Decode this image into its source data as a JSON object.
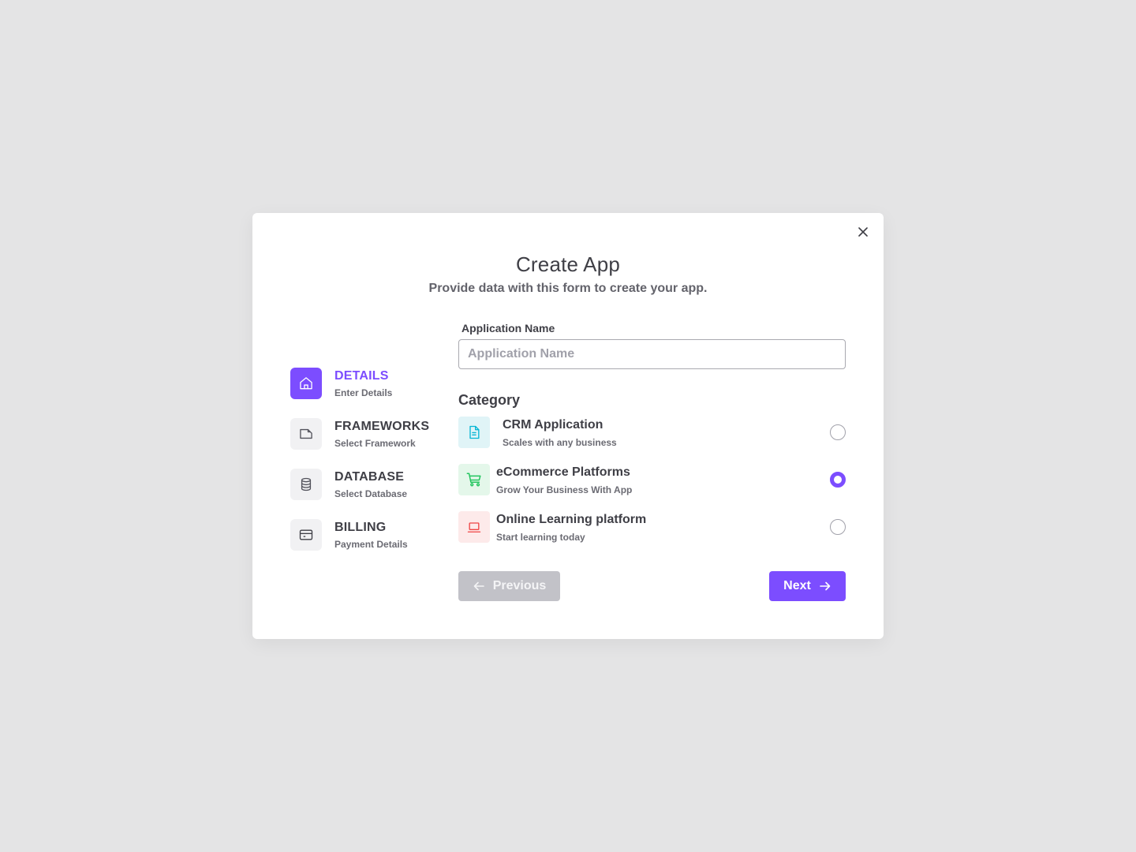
{
  "modal": {
    "title": "Create App",
    "subtitle": "Provide data with this form to create your app.",
    "close_icon": "close-icon"
  },
  "steps": [
    {
      "title": "DETAILS",
      "subtitle": "Enter Details",
      "icon": "home-icon",
      "active": true
    },
    {
      "title": "FRAMEWORKS",
      "subtitle": "Select Framework",
      "icon": "folder-icon",
      "active": false
    },
    {
      "title": "DATABASE",
      "subtitle": "Select Database",
      "icon": "database-icon",
      "active": false
    },
    {
      "title": "BILLING",
      "subtitle": "Payment Details",
      "icon": "credit-card-icon",
      "active": false
    }
  ],
  "form": {
    "app_name_label": "Application Name",
    "app_name_value": "",
    "app_name_placeholder": "Application Name",
    "category_title": "Category",
    "categories": [
      {
        "title": "CRM Application",
        "subtitle": "Scales with any business",
        "icon": "document-icon",
        "icon_color": "#06b6d4",
        "icon_bg": "#e0f4f7",
        "selected": false
      },
      {
        "title": "eCommerce Platforms",
        "subtitle": "Grow Your Business With App",
        "icon": "shopping-cart-icon",
        "icon_color": "#22c55e",
        "icon_bg": "#e4f7ea",
        "selected": true
      },
      {
        "title": "Online Learning platform",
        "subtitle": "Start learning today",
        "icon": "laptop-icon",
        "icon_color": "#ef4444",
        "icon_bg": "#fdeaea",
        "selected": false
      }
    ]
  },
  "buttons": {
    "previous_label": "Previous",
    "next_label": "Next"
  },
  "colors": {
    "accent": "#7c4dff",
    "background": "#e4e4e5",
    "disabled_button": "#c2c2c8"
  }
}
